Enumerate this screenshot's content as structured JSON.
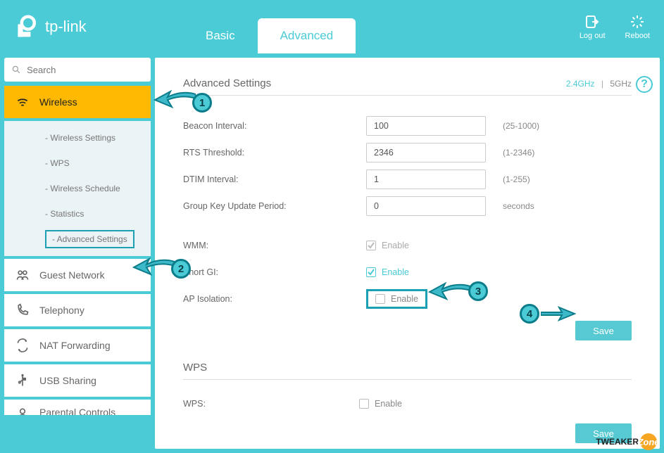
{
  "brand": "tp-link",
  "header": {
    "tabs": {
      "basic": "Basic",
      "advanced": "Advanced"
    },
    "actions": {
      "logout": "Log out",
      "reboot": "Reboot"
    }
  },
  "search": {
    "placeholder": "Search"
  },
  "nav": {
    "wireless": "Wireless",
    "subitems": {
      "wireless_settings": "- Wireless Settings",
      "wps": "- WPS",
      "wireless_schedule": "- Wireless Schedule",
      "statistics": "- Statistics",
      "advanced_settings": "- Advanced Settings"
    },
    "guest_network": "Guest Network",
    "telephony": "Telephony",
    "nat_forwarding": "NAT Forwarding",
    "usb_sharing": "USB Sharing",
    "parental_controls": "Parental Controls"
  },
  "page": {
    "title": "Advanced Settings",
    "band_active": "2.4GHz",
    "band_sep": "|",
    "band_inactive": "5GHz",
    "fields": {
      "beacon_label": "Beacon Interval:",
      "beacon_value": "100",
      "beacon_hint": "(25-1000)",
      "rts_label": "RTS Threshold:",
      "rts_value": "2346",
      "rts_hint": "(1-2346)",
      "dtim_label": "DTIM Interval:",
      "dtim_value": "1",
      "dtim_hint": "(1-255)",
      "gku_label": "Group Key Update Period:",
      "gku_value": "0",
      "gku_hint": "seconds",
      "wmm_label": "WMM:",
      "wmm_enable": "Enable",
      "shortgi_label": "Short GI:",
      "shortgi_enable": "Enable",
      "apiso_label": "AP Isolation:",
      "apiso_enable": "Enable"
    },
    "save": "Save",
    "wps_title": "WPS",
    "wps_label": "WPS:",
    "wps_enable": "Enable"
  },
  "annotations": {
    "n1": "1",
    "n2": "2",
    "n3": "3",
    "n4": "4"
  },
  "watermark": {
    "tweaker": "TWEAKER",
    "zone": "Zone"
  }
}
